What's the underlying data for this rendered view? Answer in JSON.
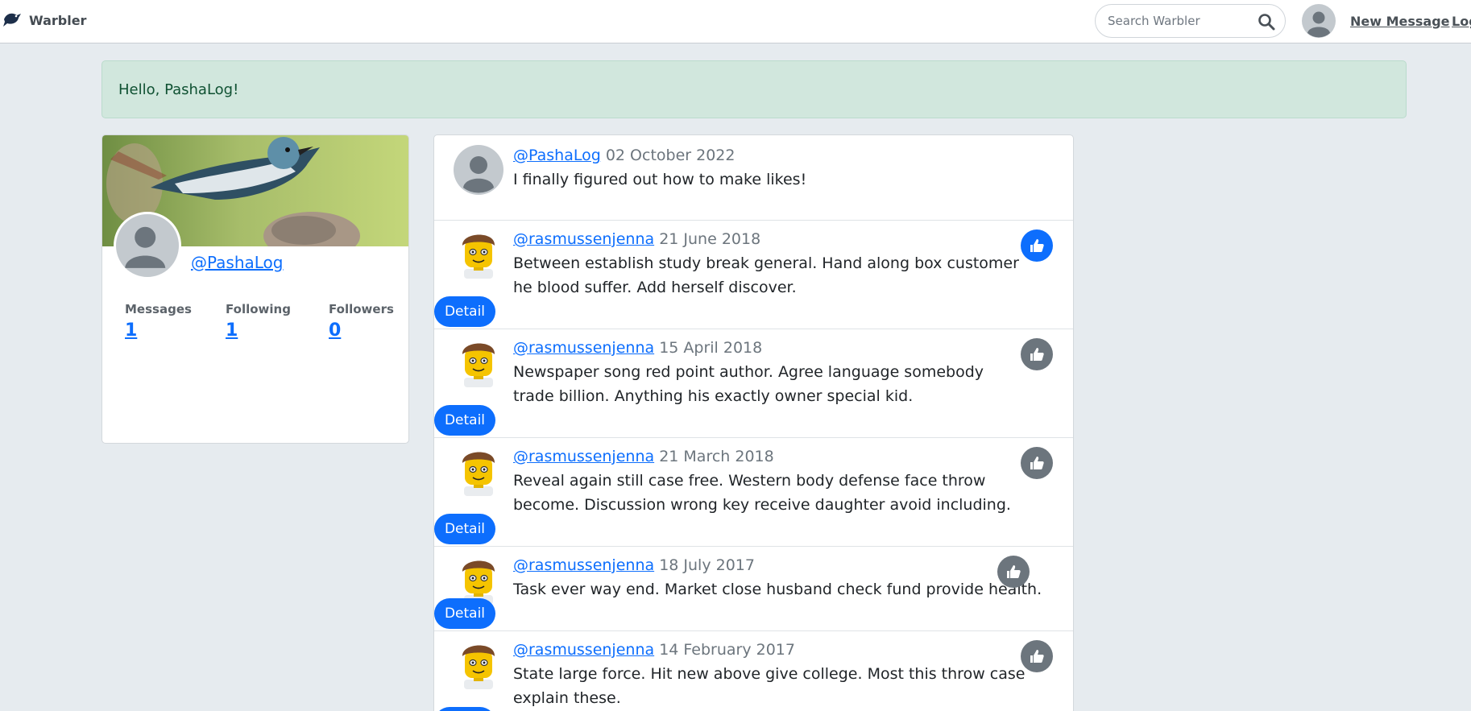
{
  "navbar": {
    "brand": "Warbler",
    "search_placeholder": "Search Warbler",
    "new_message": "New Message",
    "logout": "Log"
  },
  "alert": {
    "text": "Hello, PashaLog!"
  },
  "profile": {
    "username": "@PashaLog",
    "stats": [
      {
        "label": "Messages",
        "value": "1"
      },
      {
        "label": "Following",
        "value": "1"
      },
      {
        "label": "Followers",
        "value": "0"
      }
    ]
  },
  "feed": {
    "detail_label": "Detail",
    "messages": [
      {
        "user": "@PashaLog",
        "date": "02 October 2022",
        "text": "I finally figured out how to make likes!"
      },
      {
        "user": "@rasmussenjenna",
        "date": "21 June 2018",
        "text": "Between establish study break general. Hand along box customer he blood suffer. Add herself discover.",
        "liked": true
      },
      {
        "user": "@rasmussenjenna",
        "date": "15 April 2018",
        "text": "Newspaper song red point author. Agree language somebody trade billion. Anything his exactly owner special kid.",
        "liked": false
      },
      {
        "user": "@rasmussenjenna",
        "date": "21 March 2018",
        "text": "Reveal again still case free. Western body defense face throw become. Discussion wrong key receive daughter avoid including.",
        "liked": false
      },
      {
        "user": "@rasmussenjenna",
        "date": "18 July 2017",
        "text": "Task ever way end. Market close husband check fund provide health.",
        "liked": false
      },
      {
        "user": "@rasmussenjenna",
        "date": "14 February 2017",
        "text": "State large force. Hit new above give college. Most this throw case explain these.",
        "liked": false
      }
    ]
  },
  "colors": {
    "primary": "#0d6efd",
    "liked": "#0d6efd",
    "unliked": "#6c757d",
    "alert_bg": "#d1e7dd"
  }
}
